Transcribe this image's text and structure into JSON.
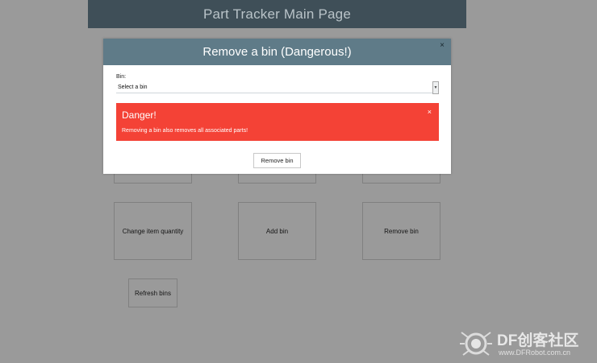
{
  "page": {
    "title": "Part Tracker Main Page"
  },
  "tiles": {
    "change_item_quantity": "Change item quantity",
    "add_bin": "Add bin",
    "remove_bin": "Remove bin",
    "refresh_bins": "Refresh bins"
  },
  "modal": {
    "title": "Remove a bin (Dangerous!)",
    "close_glyph": "×",
    "bin_label": "Bin:",
    "bin_select_value": "Select a bin",
    "alert": {
      "title": "Danger!",
      "message": "Removing a bin also removes all associated parts!",
      "close_glyph": "×"
    },
    "submit_label": "Remove bin"
  },
  "watermark": {
    "brand": "DF创客社区",
    "url": "www.DFRobot.com.cn"
  },
  "colors": {
    "backdrop": "#9a9a9a",
    "header_bg": "#3f4f58",
    "modal_header_bg": "#5f7b88",
    "danger": "#f44236"
  },
  "icons": {
    "modal_close": "close-icon",
    "alert_close": "close-icon",
    "select_arrow": "chevron-down-icon",
    "watermark": "robot-logo-icon"
  }
}
